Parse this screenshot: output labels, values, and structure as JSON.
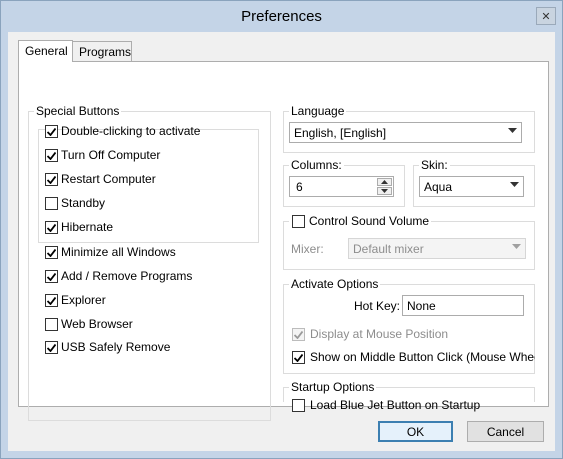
{
  "window": {
    "title": "Preferences",
    "close_glyph": "✕"
  },
  "tabs": [
    {
      "label": "General",
      "active": true
    },
    {
      "label": "Programs",
      "active": false
    }
  ],
  "special_buttons": {
    "legend": "Special Buttons",
    "items": [
      {
        "label": "Double-clicking to activate",
        "checked": true
      },
      {
        "label": "Turn Off Computer",
        "checked": true
      },
      {
        "label": "Restart Computer",
        "checked": true
      },
      {
        "label": "Standby",
        "checked": false
      },
      {
        "label": "Hibernate",
        "checked": true
      },
      {
        "label": "Minimize all Windows",
        "checked": true
      },
      {
        "label": "Add / Remove Programs",
        "checked": true
      },
      {
        "label": "Explorer",
        "checked": true
      },
      {
        "label": "Web Browser",
        "checked": false
      },
      {
        "label": "USB Safely Remove",
        "checked": true
      }
    ]
  },
  "language": {
    "legend": "Language",
    "value": "English, [English]"
  },
  "columns": {
    "legend": "Columns:",
    "value": "6"
  },
  "skin": {
    "legend": "Skin:",
    "value": "Aqua"
  },
  "sound": {
    "label": "Control Sound Volume",
    "checked": false,
    "mixer_label": "Mixer:",
    "mixer_value": "Default mixer"
  },
  "activate": {
    "legend": "Activate Options",
    "hotkey_label": "Hot Key:",
    "hotkey_value": "None",
    "display_at_mouse": {
      "label": "Display at Mouse Position",
      "checked": true,
      "disabled": true
    },
    "middle_click": {
      "label": "Show on Middle Button Click (Mouse Wheel)",
      "checked": true
    }
  },
  "startup": {
    "legend": "Startup Options",
    "load_on_startup": {
      "label": "Load Blue Jet Button on Startup",
      "checked": false
    }
  },
  "buttons": {
    "ok": "OK",
    "cancel": "Cancel"
  },
  "colors": {
    "accent": "#3c7fb1",
    "title_bar": "#c4d4e7"
  }
}
